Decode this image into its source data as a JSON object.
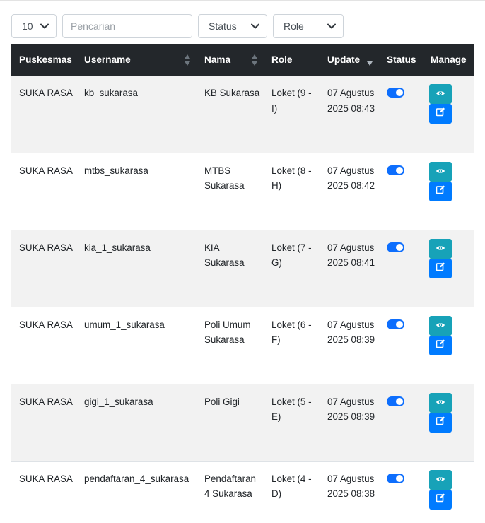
{
  "filters": {
    "page_length": "10",
    "search_placeholder": "Pencarian",
    "status_select": "Status",
    "role_select": "Role"
  },
  "table": {
    "headers": {
      "puskesmas": "Puskesmas",
      "username": "Username",
      "nama": "Nama",
      "role": "Role",
      "update": "Update",
      "status": "Status",
      "manage": "Manage"
    },
    "rows": [
      {
        "puskesmas": "SUKA RASA",
        "username": "kb_sukarasa",
        "nama": "KB Sukarasa",
        "role": "Loket (9 - I)",
        "update": "07 Agustus 2025 08:43",
        "status": "on"
      },
      {
        "puskesmas": "SUKA RASA",
        "username": "mtbs_sukarasa",
        "nama": "MTBS Sukarasa",
        "role": "Loket (8 - H)",
        "update": "07 Agustus 2025 08:42",
        "status": "on"
      },
      {
        "puskesmas": "SUKA RASA",
        "username": "kia_1_sukarasa",
        "nama": "KIA Sukarasa",
        "role": "Loket (7 - G)",
        "update": "07 Agustus 2025 08:41",
        "status": "on"
      },
      {
        "puskesmas": "SUKA RASA",
        "username": "umum_1_sukarasa",
        "nama": "Poli Umum Sukarasa",
        "role": "Loket (6 - F)",
        "update": "07 Agustus 2025 08:39",
        "status": "on"
      },
      {
        "puskesmas": "SUKA RASA",
        "username": "gigi_1_sukarasa",
        "nama": "Poli Gigi",
        "role": "Loket (5 - E)",
        "update": "07 Agustus 2025 08:39",
        "status": "on"
      },
      {
        "puskesmas": "SUKA RASA",
        "username": "pendaftaran_4_sukarasa",
        "nama": "Pendaftaran 4 Sukarasa",
        "role": "Loket (4 - D)",
        "update": "07 Agustus 2025 08:38",
        "status": "on"
      }
    ]
  },
  "colors": {
    "header_bg": "#23272b",
    "toggle_on": "#0d6efd",
    "view_button": "#17a2b8",
    "edit_button": "#007bff"
  },
  "icons": {
    "view": "eye-icon",
    "edit": "edit-icon",
    "sort": "sort-icon",
    "dropdown": "chevron-down-icon"
  }
}
